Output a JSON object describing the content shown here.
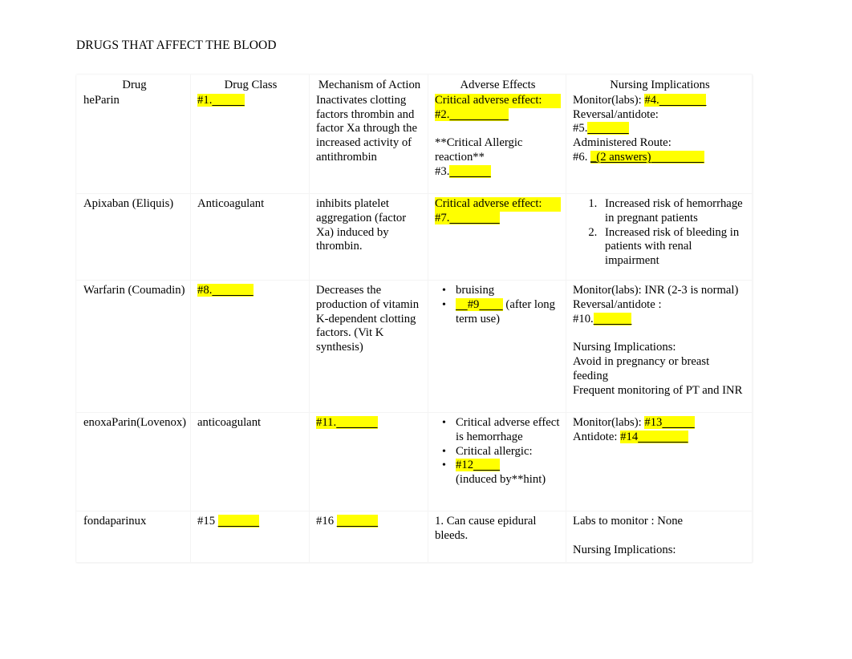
{
  "document": {
    "title": "DRUGS THAT AFFECT THE BLOOD"
  },
  "table": {
    "headers": {
      "drug": "Drug",
      "drug_class": "Drug Class",
      "mechanism": "Mechanism of Action",
      "adverse": "Adverse Effects",
      "nursing": "Nursing Implications"
    },
    "rows": [
      {
        "drug": "heParin",
        "drug_class_blank": "#1.",
        "mechanism": "Inactivates clotting factors thrombin and factor Xa through the increased activity of antithrombin",
        "adverse": {
          "critical_label": "Critical adverse effect:",
          "blank_2": "#2.",
          "allergic_label": "**Critical Allergic reaction**",
          "blank_3": "#3."
        },
        "nursing": {
          "monitor_label": "Monitor(labs):",
          "blank_4": "#4.",
          "reversal_label": "Reversal/antidote:",
          "blank_5": "#5.",
          "route_label": "Administered Route:",
          "blank_6": "#6.",
          "blank_6_hint": "_(2 answers)"
        }
      },
      {
        "drug": "Apixaban (Eliquis)",
        "drug_class": "Anticoagulant",
        "mechanism": "inhibits platelet aggregation (factor Xa) induced by thrombin.",
        "adverse": {
          "critical_label": "Critical adverse effect:",
          "blank_7": "#7."
        },
        "nursing_list": [
          "Increased risk of hemorrhage in pregnant patients",
          "Increased risk of bleeding in patients with renal impairment"
        ]
      },
      {
        "drug": "Warfarin (Coumadin)",
        "drug_class_blank": "#8.",
        "mechanism": "Decreases the production of vitamin K-dependent clotting factors. (Vit K synthesis)",
        "adverse_bullets": [
          {
            "text": "bruising"
          },
          {
            "blank": "#9",
            "after": "(after long term use)"
          }
        ],
        "nursing": {
          "monitor": "Monitor(labs):  INR (2-3 is normal)",
          "reversal_label": "Reversal/antidote  :",
          "blank_10": "#10.",
          "implications_label": "Nursing Implications:",
          "implication_1": "Avoid in pregnancy or breast feeding",
          "implication_2": "Frequent monitoring of PT and INR"
        }
      },
      {
        "drug": "enoxaParin(Lovenox)",
        "drug_class": "anticoagulant",
        "mechanism_blank": "#11.",
        "adverse_bullets": [
          {
            "text": "Critical adverse effect is hemorrhage"
          },
          {
            "text": "Critical allergic:"
          },
          {
            "blank": "#12",
            "after": "(induced by**hint)"
          }
        ],
        "nursing": {
          "monitor_label": "Monitor(labs):",
          "blank_13": "#13",
          "antidote_label": "Antidote:",
          "blank_14": "#14"
        }
      },
      {
        "drug": "fondaparinux",
        "drug_class_blank": "#15",
        "mechanism_blank": "#16",
        "adverse_numbered": "1. Can cause epidural bleeds.",
        "nursing": {
          "labs": "Labs to monitor :  None",
          "implications_label": "Nursing Implications:"
        }
      }
    ]
  },
  "colors": {
    "highlight": "#ffff00",
    "text": "#000000",
    "background": "#ffffff"
  }
}
